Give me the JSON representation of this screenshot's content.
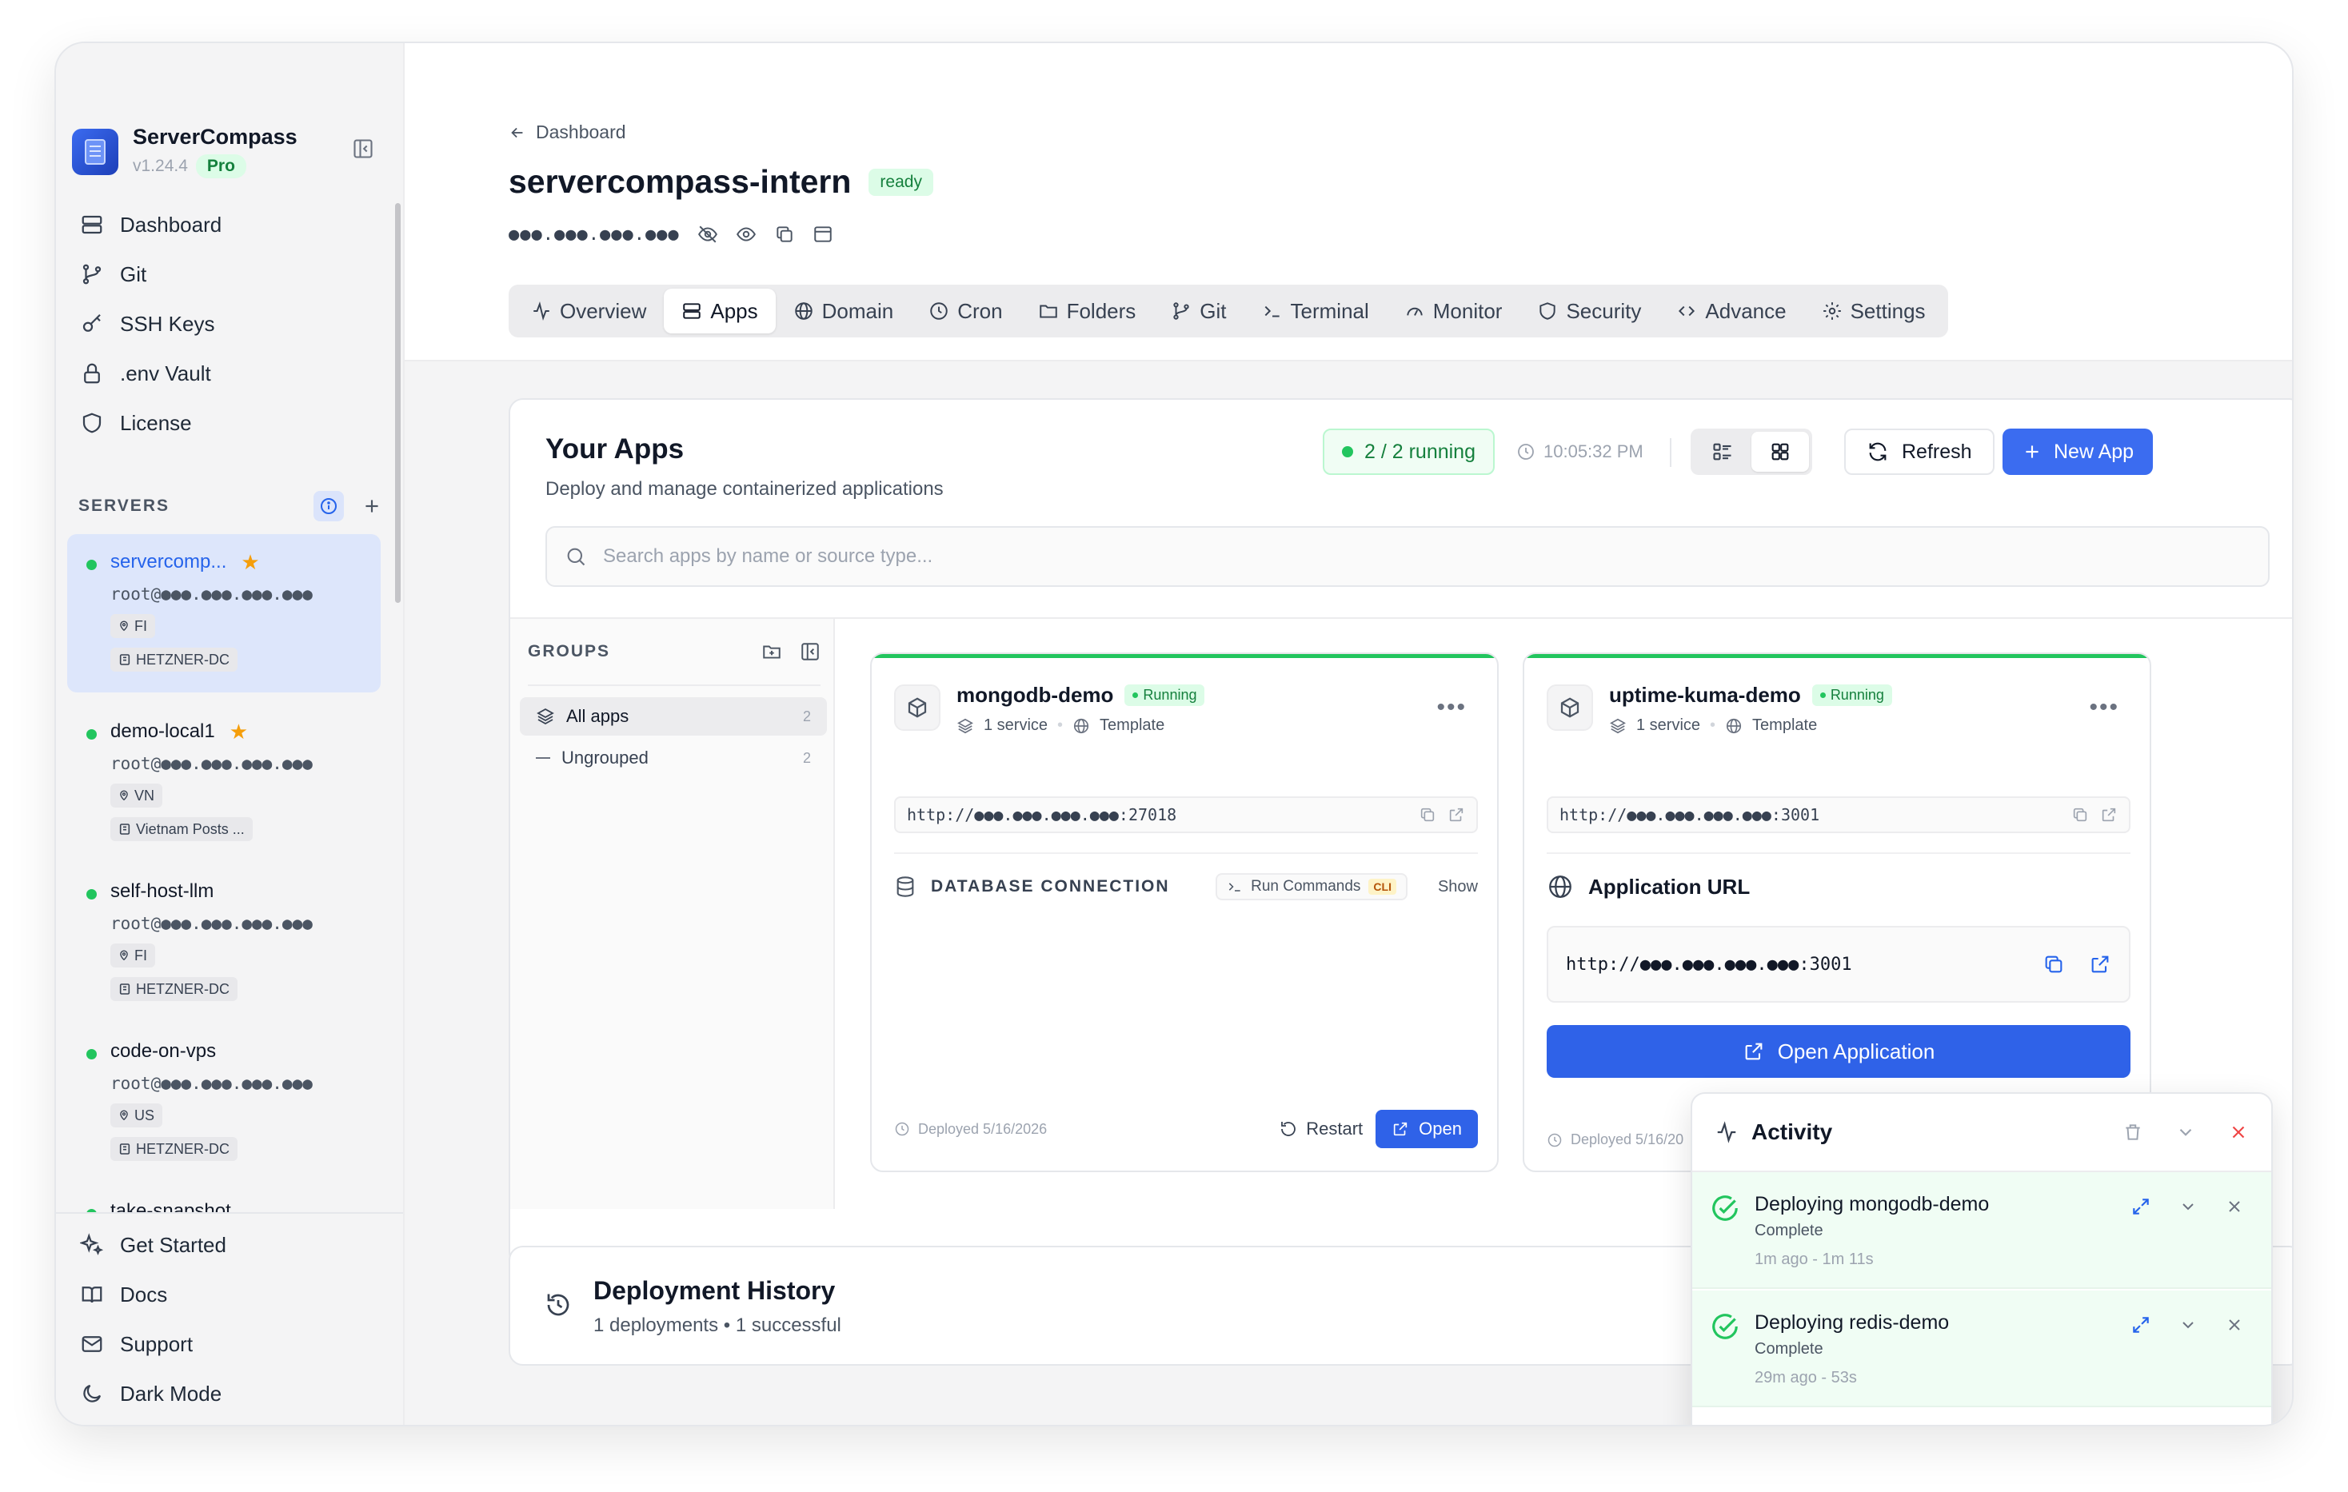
{
  "app": {
    "name": "ServerCompass",
    "version": "v1.24.4",
    "plan": "Pro"
  },
  "nav": [
    {
      "label": "Dashboard",
      "icon": "dashboard-icon"
    },
    {
      "label": "Git",
      "icon": "git-branch-icon"
    },
    {
      "label": "SSH Keys",
      "icon": "key-icon"
    },
    {
      "label": ".env Vault",
      "icon": "lock-icon"
    },
    {
      "label": "License",
      "icon": "shield-icon"
    }
  ],
  "servers": {
    "title": "SERVERS",
    "items": [
      {
        "name": "servercomp...",
        "host": "root@●●●.●●●.●●●.●●●",
        "region": "FI",
        "provider": "HETZNER-DC",
        "starred": true,
        "active": true
      },
      {
        "name": "demo-local1",
        "host": "root@●●●.●●●.●●●.●●●",
        "region": "VN",
        "provider": "Vietnam Posts ...",
        "starred": true,
        "active": false
      },
      {
        "name": "self-host-llm",
        "host": "root@●●●.●●●.●●●.●●●",
        "region": "FI",
        "provider": "HETZNER-DC",
        "starred": false,
        "active": false
      },
      {
        "name": "code-on-vps",
        "host": "root@●●●.●●●.●●●.●●●",
        "region": "US",
        "provider": "HETZNER-DC",
        "starred": false,
        "active": false
      },
      {
        "name": "take-snapshot",
        "host": "",
        "region": "",
        "provider": "",
        "starred": false,
        "active": false
      }
    ]
  },
  "bottom_nav": [
    {
      "label": "Get Started",
      "icon": "sparkles-icon"
    },
    {
      "label": "Docs",
      "icon": "book-icon"
    },
    {
      "label": "Support",
      "icon": "mail-icon"
    },
    {
      "label": "Dark Mode",
      "icon": "moon-icon"
    }
  ],
  "header": {
    "back_label": "Dashboard",
    "title": "servercompass-intern",
    "status": "ready",
    "ip_masked": "●●●.●●●.●●●.●●●"
  },
  "tabs": [
    {
      "label": "Overview",
      "icon": "activity-icon",
      "active": false
    },
    {
      "label": "Apps",
      "icon": "layers-icon",
      "active": true
    },
    {
      "label": "Domain",
      "icon": "globe-icon",
      "active": false
    },
    {
      "label": "Cron",
      "icon": "clock-icon",
      "active": false
    },
    {
      "label": "Folders",
      "icon": "folder-icon",
      "active": false
    },
    {
      "label": "Git",
      "icon": "git-branch-icon",
      "active": false
    },
    {
      "label": "Terminal",
      "icon": "terminal-icon",
      "active": false
    },
    {
      "label": "Monitor",
      "icon": "gauge-icon",
      "active": false
    },
    {
      "label": "Security",
      "icon": "shield-icon",
      "active": false
    },
    {
      "label": "Advance",
      "icon": "code-icon",
      "active": false
    },
    {
      "label": "Settings",
      "icon": "gear-icon",
      "active": false
    }
  ],
  "apps_panel": {
    "title": "Your Apps",
    "subtitle": "Deploy and manage containerized applications",
    "running": "2 / 2 running",
    "time": "10:05:32 PM",
    "refresh_label": "Refresh",
    "new_app_label": "New App",
    "search_placeholder": "Search apps by name or source type..."
  },
  "groups": {
    "title": "GROUPS",
    "items": [
      {
        "label": "All apps",
        "count": "2",
        "active": true
      },
      {
        "label": "Ungrouped",
        "count": "2",
        "active": false
      }
    ]
  },
  "apps": [
    {
      "name": "mongodb-demo",
      "status": "Running",
      "services": "1 service",
      "source": "Template",
      "url": "http://●●●.●●●.●●●.●●●:27018",
      "db_label": "DATABASE CONNECTION",
      "run_commands": "Run Commands",
      "cli": "CLI",
      "show": "Show",
      "deployed": "Deployed 5/16/2026",
      "restart": "Restart",
      "open": "Open"
    },
    {
      "name": "uptime-kuma-demo",
      "status": "Running",
      "services": "1 service",
      "source": "Template",
      "url": "http://●●●.●●●.●●●.●●●:3001",
      "app_url_label": "Application URL",
      "app_url": "http://●●●.●●●.●●●.●●●:3001",
      "open_app": "Open Application",
      "deployed": "Deployed 5/16/20"
    }
  ],
  "history": {
    "title": "Deployment History",
    "subtitle": "1 deployments • 1 successful"
  },
  "activity": {
    "title": "Activity",
    "items": [
      {
        "name": "Deploying mongodb-demo",
        "status": "Complete",
        "when": "1m ago  -  1m 11s"
      },
      {
        "name": "Deploying redis-demo",
        "status": "Complete",
        "when": "29m ago  -  53s"
      }
    ]
  },
  "colors": {
    "accent": "#2f62e8",
    "success": "#22c55e",
    "star": "#f59e0b",
    "danger": "#ef4444"
  }
}
